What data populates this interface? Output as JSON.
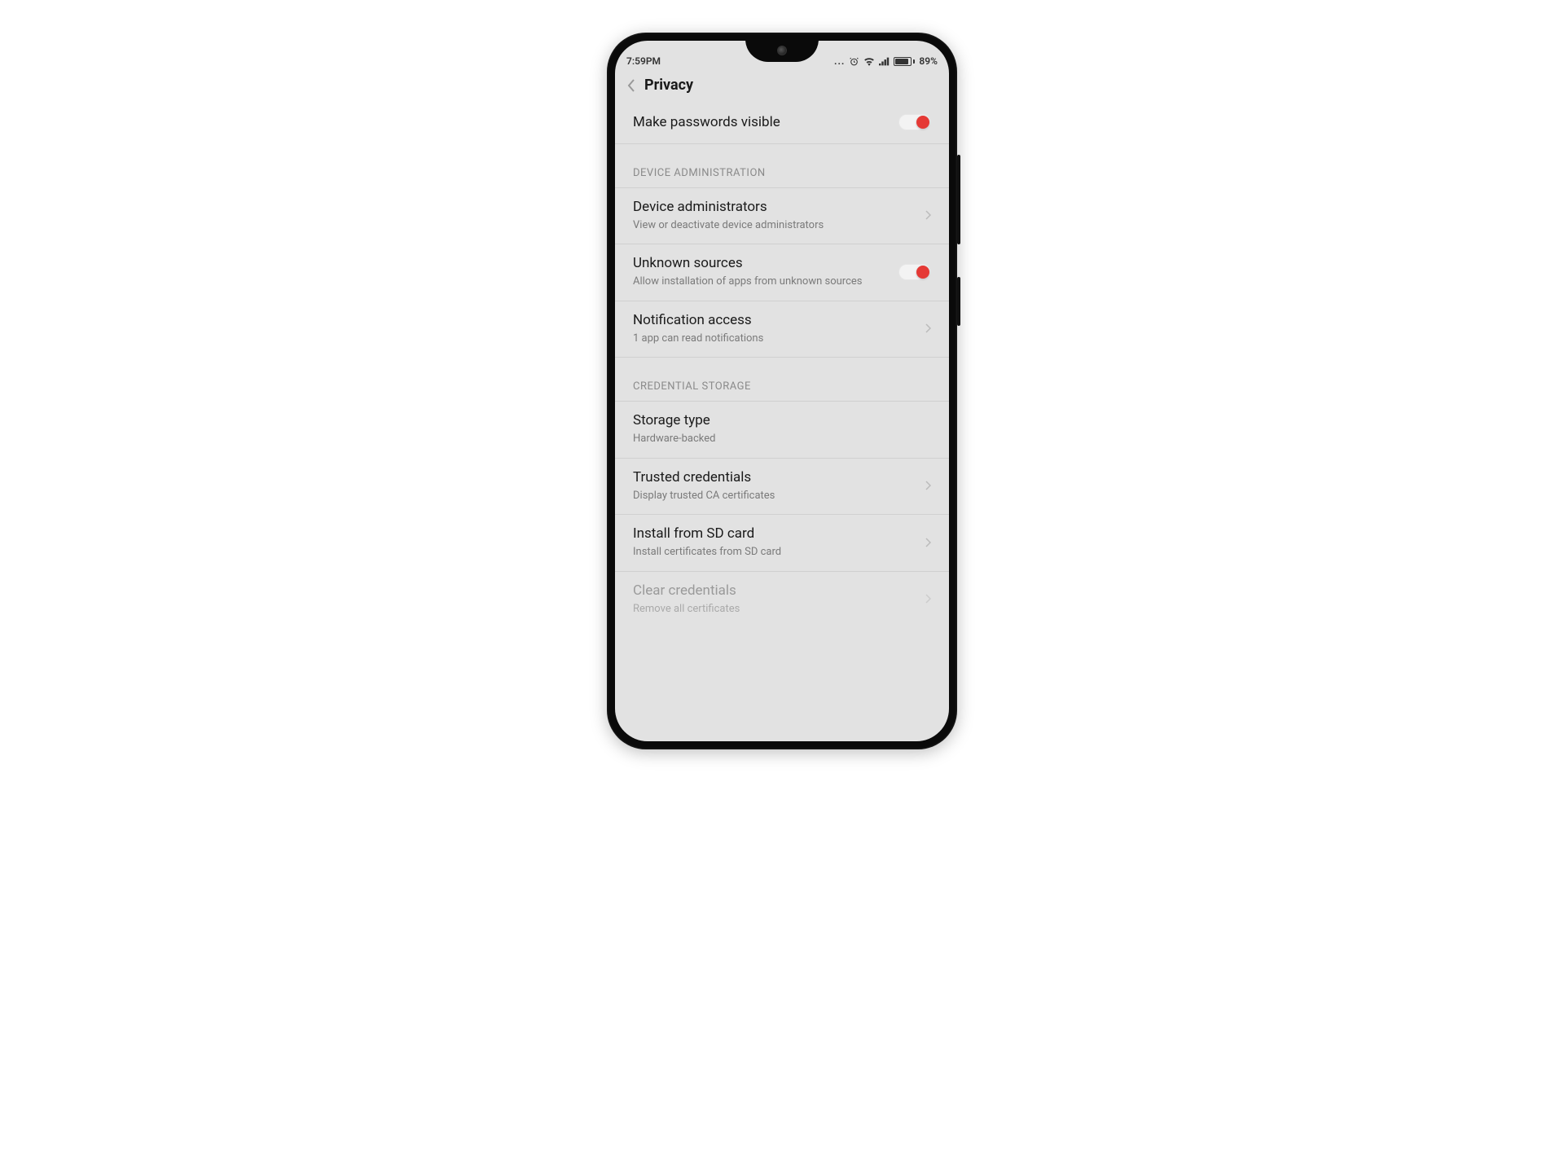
{
  "status": {
    "time": "7:59PM",
    "battery_pct": "89%"
  },
  "header": {
    "title": "Privacy"
  },
  "rows": {
    "make_passwords": {
      "title": "Make passwords visible"
    },
    "section_admin": "DEVICE ADMINISTRATION",
    "device_admins": {
      "title": "Device administrators",
      "sub": "View or deactivate device administrators"
    },
    "unknown_sources": {
      "title": "Unknown sources",
      "sub": "Allow installation of apps from unknown sources"
    },
    "notification_access": {
      "title": "Notification access",
      "sub": "1 app can read notifications"
    },
    "section_cred": "CREDENTIAL STORAGE",
    "storage_type": {
      "title": "Storage type",
      "sub": "Hardware-backed"
    },
    "trusted_credentials": {
      "title": "Trusted credentials",
      "sub": "Display trusted CA certificates"
    },
    "install_sd": {
      "title": "Install from SD card",
      "sub": "Install certificates from SD card"
    },
    "clear_credentials": {
      "title": "Clear credentials",
      "sub": "Remove all certificates"
    }
  }
}
